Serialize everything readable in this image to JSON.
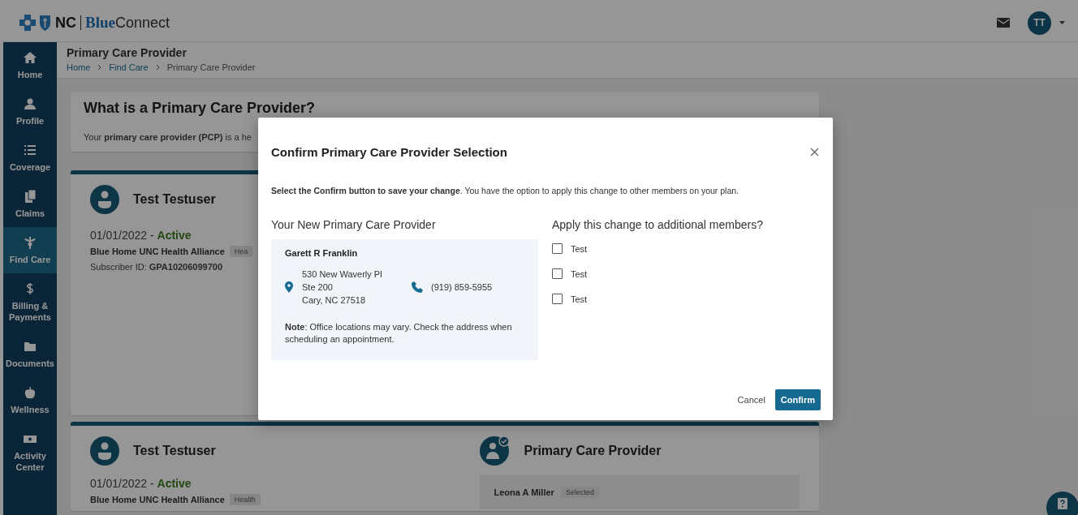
{
  "header": {
    "logo": {
      "nc": "NC",
      "blue": "Blue",
      "connect": "Connect"
    },
    "avatar": "TT"
  },
  "sidebar": {
    "items": [
      {
        "label": "Home",
        "selected": false
      },
      {
        "label": "Profile",
        "selected": false
      },
      {
        "label": "Coverage",
        "selected": false
      },
      {
        "label": "Claims",
        "selected": false
      },
      {
        "label": "Find Care",
        "selected": true
      },
      {
        "label": "Billing & Payments",
        "selected": false
      },
      {
        "label": "Documents",
        "selected": false
      },
      {
        "label": "Wellness",
        "selected": false
      },
      {
        "label": "Activity Center",
        "selected": false
      }
    ]
  },
  "page": {
    "title": "Primary Care Provider",
    "breadcrumb": [
      {
        "label": "Home",
        "kind": "link"
      },
      {
        "label": "Find Care",
        "kind": "link"
      },
      {
        "label": "Primary Care Provider",
        "kind": "current"
      }
    ]
  },
  "intro": {
    "title": "What is a Primary Care Provider?",
    "text": "Your **primary care provider (PCP)** is a he"
  },
  "member_card": {
    "name": "Test Testuser",
    "date": "01/01/2022 - ",
    "status": "Active",
    "plan": "Blue Home UNC Health Alliance",
    "badge": "Hea",
    "subscriber": "Subscriber ID: **GPA10206099700**"
  },
  "second_card": {
    "member": {
      "name": "Test Testuser",
      "date": "01/01/2022 - ",
      "status": "Active",
      "plan": "Blue Home UNC Health Alliance",
      "badge": "Health"
    },
    "pcp": {
      "title": "Primary Care Provider",
      "provider": "Leona A Miller",
      "badge": "Selected"
    }
  },
  "modal": {
    "title": "Confirm Primary Care Provider Selection",
    "intro": "**Select the Confirm button to save your change**. You have the option to apply this change to other members on your plan.",
    "provider_heading": "Your New Primary Care Provider",
    "provider": {
      "name": "Garett R Franklin",
      "address": [
        "530 New Waverly Pl",
        "Ste 200",
        "Cary, NC 27518"
      ],
      "phone": "(919) 859-5955",
      "note": "**Note**: Office locations may vary. Check the address when scheduling an appointment."
    },
    "members_heading": "Apply this change to additional members?",
    "members": [
      {
        "label": "Test",
        "checked": false
      },
      {
        "label": "Test",
        "checked": false
      },
      {
        "label": "Test",
        "checked": false
      }
    ],
    "buttons": [
      {
        "label": "Cancel",
        "kind": "text"
      },
      {
        "label": "Confirm",
        "kind": "primary"
      }
    ]
  }
}
